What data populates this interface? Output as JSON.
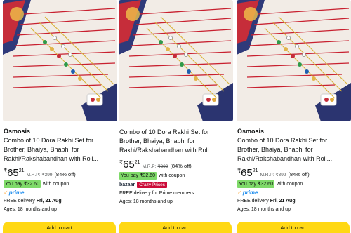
{
  "products": [
    {
      "brand": "Osmosis",
      "title_lines": [
        "Combo of 10 Dora Rakhi Set for",
        "Brother, Bhaiya, Bhabhi for",
        "Rakhi/Rakshabandhan with Roli..."
      ],
      "price_symbol": "₹",
      "price_whole": "65",
      "price_fraction": "21",
      "mrp_label": "M.R.P:",
      "mrp_value": "₹399",
      "discount": "(84% off)",
      "coupon": "You pay ₹32.60",
      "coupon_suffix": "with coupon",
      "prime": "prime",
      "delivery_prefix": "FREE delivery",
      "delivery_date": "Fri, 21 Aug",
      "ages": "Ages: 18 months and up",
      "cart_label": "Add to cart"
    },
    {
      "brand": "",
      "title_lines": [
        "Combo of 10 Dora Rakhi Set for",
        "Brother, Bhaiya, Bhabhi for",
        "Rakhi/Rakshabandhan with Roli..."
      ],
      "price_symbol": "₹",
      "price_whole": "65",
      "price_fraction": "21",
      "mrp_label": "M.R.P:",
      "mrp_value": "₹399",
      "discount": "(84% off)",
      "coupon": "You pay ₹32.60",
      "coupon_suffix": "with coupon",
      "bazaar": "bazaar",
      "crazy_prices": "Crazy Prices",
      "delivery_text": "FREE delivery for Prime members",
      "ages": "Ages: 18 months and up",
      "cart_label": "Add to cart"
    },
    {
      "brand": "Osmosis",
      "title_lines": [
        "Combo of 10 Dora Rakhi Set for",
        "Brother, Bhaiya, Bhabhi for",
        "Rakhi/Rakshabandhan with Roli..."
      ],
      "price_symbol": "₹",
      "price_whole": "65",
      "price_fraction": "21",
      "mrp_label": "M.R.P:",
      "mrp_value": "₹399",
      "discount": "(84% off)",
      "coupon": "You pay ₹32.60",
      "coupon_suffix": "with coupon",
      "prime": "prime",
      "delivery_prefix": "FREE delivery",
      "delivery_date": "Fri, 21 Aug",
      "ages": "Ages: 18 months and up",
      "cart_label": "Add to cart"
    }
  ],
  "colors": {
    "cart_button": "#ffd814",
    "coupon_badge": "#7fda69",
    "prime": "#1f8ded",
    "crazy_badge": "#cc0c39"
  }
}
